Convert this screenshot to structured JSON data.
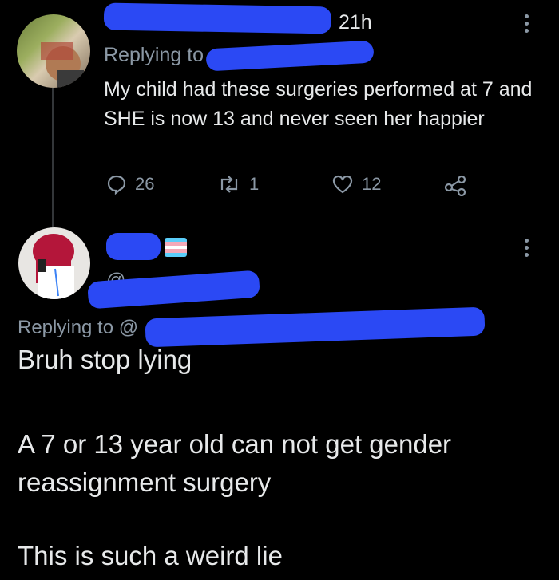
{
  "tweet1": {
    "time": "21h",
    "replying_to": "Replying to",
    "text": "My child had these surgeries performed at 7 and SHE is now 13 and never seen her happier",
    "actions": {
      "replies": "26",
      "retweets": "1",
      "likes": "12"
    }
  },
  "tweet2": {
    "handle_prefix": "@",
    "replying_to": "Replying to @",
    "line1": "Bruh stop lying",
    "line2": "A 7 or 13 year old can not get gender reassignment surgery",
    "line3": "This is such a weird lie"
  },
  "colors": {
    "background": "#000000",
    "text": "#e7e9ea",
    "muted": "#8b98a5",
    "redaction": "#2b49f4"
  },
  "icons": [
    "reply-icon",
    "retweet-icon",
    "like-icon",
    "share-icon",
    "more-icon",
    "trans-flag-emoji"
  ]
}
